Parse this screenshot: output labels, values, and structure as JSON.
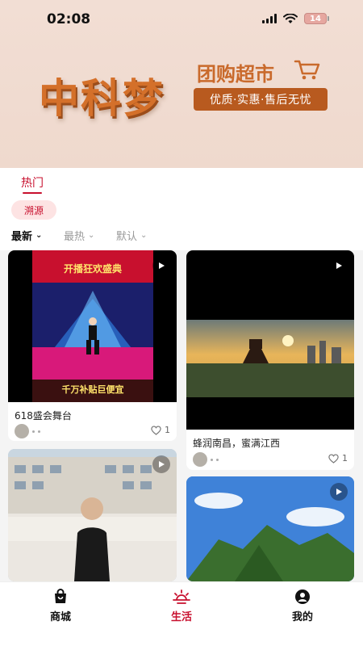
{
  "status": {
    "time": "02:08",
    "battery": "14"
  },
  "banner": {
    "brand": "中科梦",
    "tagline_main": "团购超市",
    "tagline_pill": "优质·实惠·售后无忧"
  },
  "tabs": {
    "active": "热门",
    "chip": "溯源"
  },
  "sort": {
    "option1": "最新",
    "option2": "最热",
    "option3": "默认"
  },
  "feed": {
    "cards": [
      {
        "title": "618盛会舞台",
        "likes": "1",
        "overlay_top": "开播狂欢盛典",
        "overlay_sub": "千万补贴巨便宜",
        "overlay_bottom": "千万补贴巨便宜"
      },
      {
        "title": "蜂润南昌，蜜满江西",
        "likes": "1"
      },
      {
        "title": ""
      },
      {
        "title": ""
      }
    ]
  },
  "nav": {
    "item1": "商城",
    "item2": "生活",
    "item3": "我的"
  },
  "colors": {
    "accent": "#c8102e",
    "brand": "#d4702a"
  }
}
